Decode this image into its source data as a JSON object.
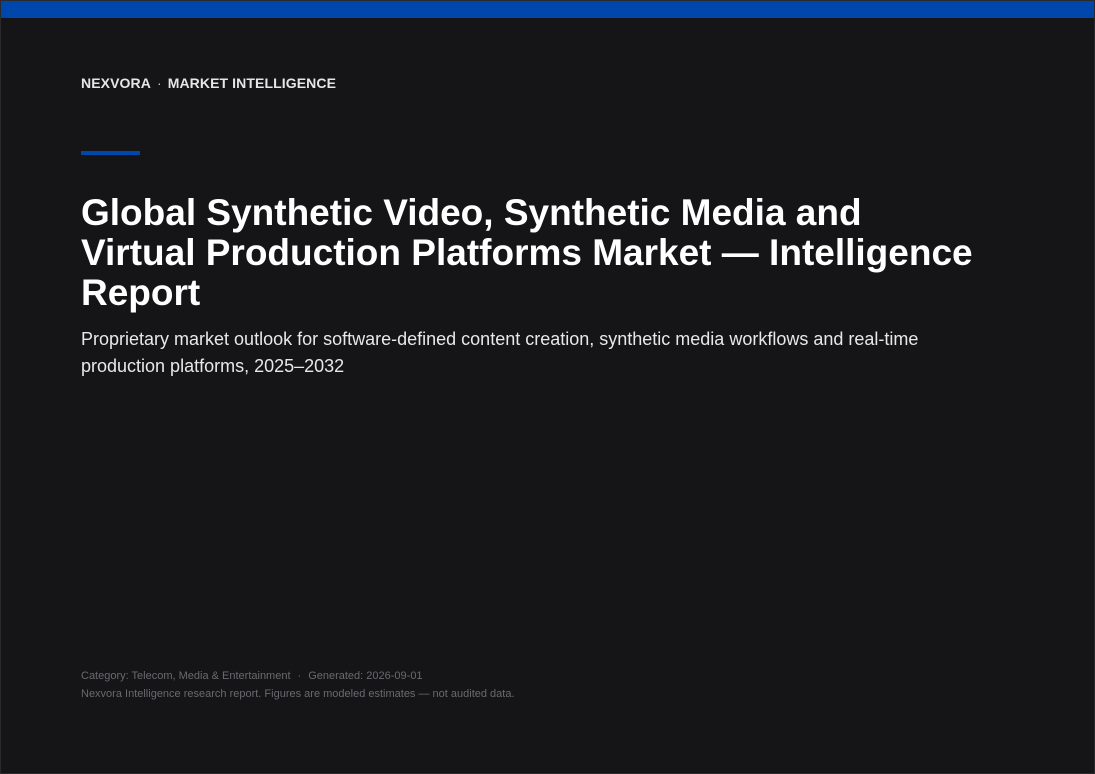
{
  "header": {
    "brand": "NEXVORA",
    "separator": "·",
    "section": "MARKET INTELLIGENCE"
  },
  "cover": {
    "title": "Global Synthetic Video, Synthetic Media and Virtual Production Platforms Market — Intelligence Report",
    "subtitle": "Proprietary market outlook for software-defined content creation, synthetic media workflows and real-time production platforms, 2025–2032"
  },
  "footer": {
    "category": "Category: Telecom, Media & Entertainment",
    "separator": "·",
    "generated": "Generated: 2026-09-01",
    "disclaimer": "Nexvora Intelligence research report. Figures are modeled estimates — not audited data."
  },
  "colors": {
    "background": "#151517",
    "accent": "#0047ab",
    "title": "#ffffff",
    "muted": "#6a6a6e"
  }
}
